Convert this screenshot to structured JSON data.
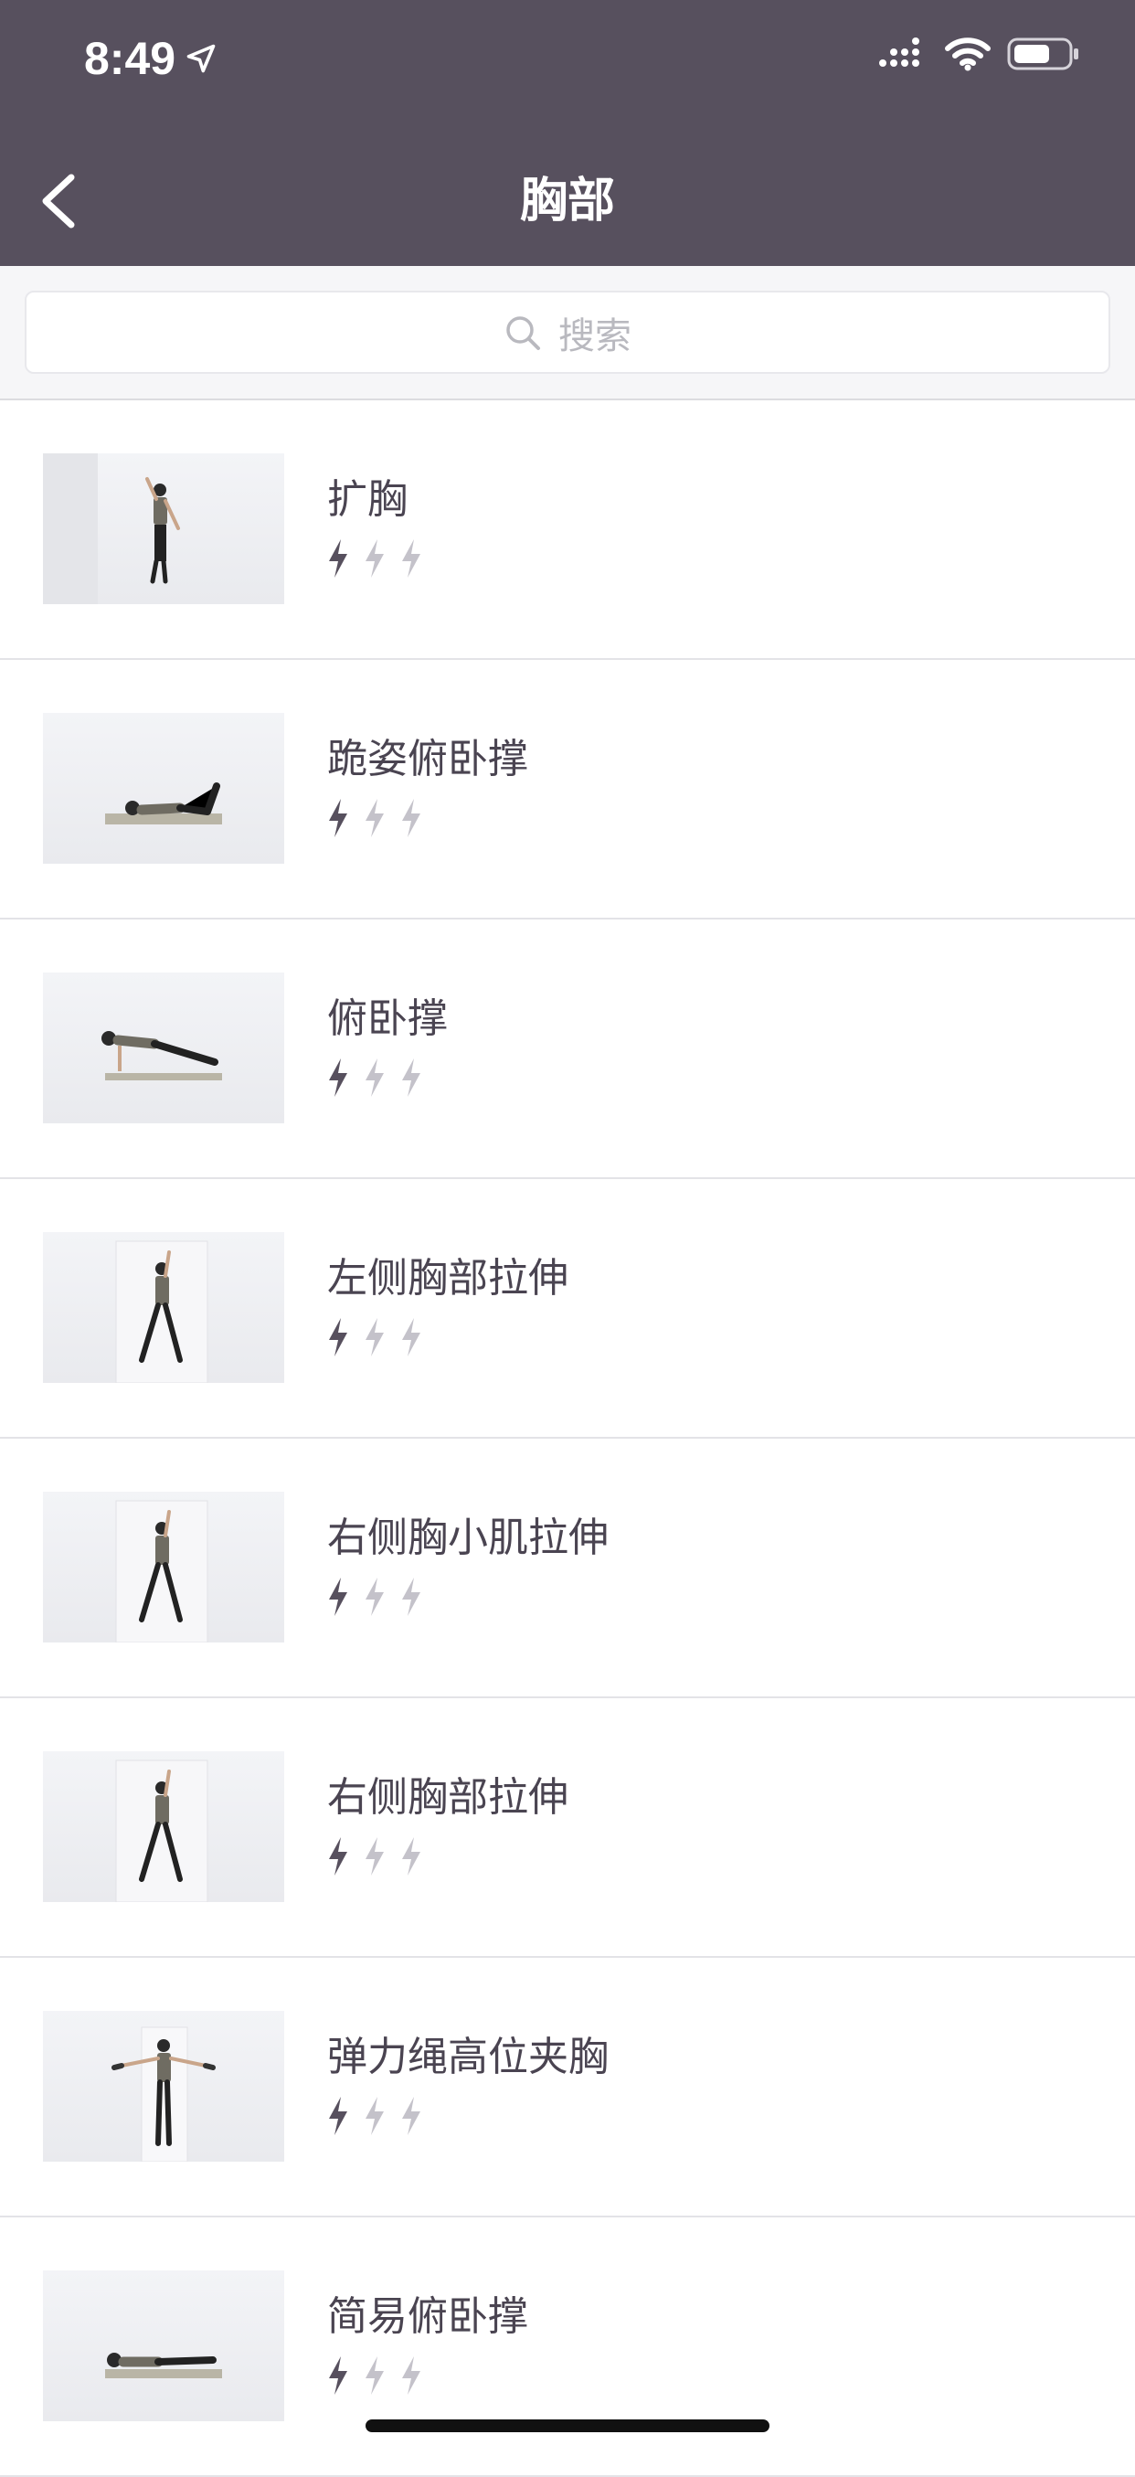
{
  "status_bar": {
    "time": "8:49"
  },
  "header": {
    "title": "胸部"
  },
  "search": {
    "placeholder": "搜索"
  },
  "colors": {
    "header_bg": "#57505e",
    "bolt_active": "#57505e",
    "bolt_inactive": "#c4c2ca"
  },
  "exercises": [
    {
      "name": "扩胸",
      "difficulty": 1,
      "pose": "standing-arm-up"
    },
    {
      "name": "跪姿俯卧撑",
      "difficulty": 1,
      "pose": "kneeling-pushup"
    },
    {
      "name": "俯卧撑",
      "difficulty": 1,
      "pose": "plank-pushup"
    },
    {
      "name": "左侧胸部拉伸",
      "difficulty": 1,
      "pose": "wall-stretch"
    },
    {
      "name": "右侧胸小肌拉伸",
      "difficulty": 1,
      "pose": "wall-stretch"
    },
    {
      "name": "右侧胸部拉伸",
      "difficulty": 1,
      "pose": "wall-stretch"
    },
    {
      "name": "弹力绳高位夹胸",
      "difficulty": 1,
      "pose": "band-fly"
    },
    {
      "name": "简易俯卧撑",
      "difficulty": 1,
      "pose": "floor-pushup"
    }
  ]
}
